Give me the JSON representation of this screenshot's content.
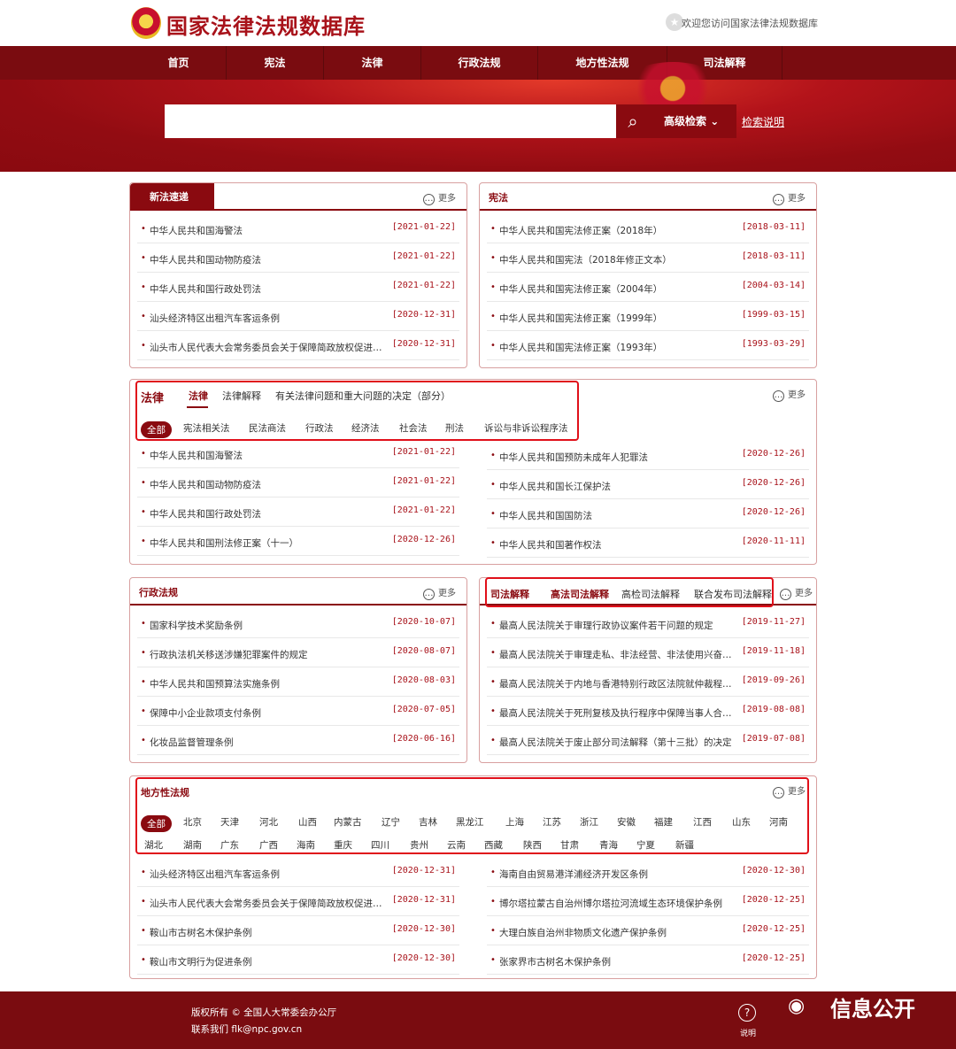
{
  "header": {
    "site_title": "国家法律法规数据库",
    "welcome": "欢迎您访问国家法律法规数据库"
  },
  "nav": [
    "首页",
    "宪法",
    "法律",
    "行政法规",
    "地方性法规",
    "司法解释"
  ],
  "search": {
    "placeholder": "",
    "advanced": "高级检索",
    "help": "检索说明"
  },
  "more": "更多",
  "panel_new": {
    "title": "新法速递",
    "rows": [
      {
        "t": "中华人民共和国海警法",
        "d": "[2021-01-22]"
      },
      {
        "t": "中华人民共和国动物防疫法",
        "d": "[2021-01-22]"
      },
      {
        "t": "中华人民共和国行政处罚法",
        "d": "[2021-01-22]"
      },
      {
        "t": "汕头经济特区出租汽车客运条例",
        "d": "[2020-12-31]"
      },
      {
        "t": "汕头市人民代表大会常务委员会关于保障简政放权促进…",
        "d": "[2020-12-31]"
      }
    ]
  },
  "panel_const": {
    "title": "宪法",
    "rows": [
      {
        "t": "中华人民共和国宪法修正案（2018年）",
        "d": "[2018-03-11]"
      },
      {
        "t": "中华人民共和国宪法（2018年修正文本）",
        "d": "[2018-03-11]"
      },
      {
        "t": "中华人民共和国宪法修正案（2004年）",
        "d": "[2004-03-14]"
      },
      {
        "t": "中华人民共和国宪法修正案（1999年）",
        "d": "[1999-03-15]"
      },
      {
        "t": "中华人民共和国宪法修正案（1993年）",
        "d": "[1993-03-29]"
      }
    ]
  },
  "panel_law": {
    "title": "法律",
    "tabs": [
      "法律",
      "法律解释",
      "有关法律问题和重大问题的决定（部分）"
    ],
    "chips": [
      "全部",
      "宪法相关法",
      "民法商法",
      "行政法",
      "经济法",
      "社会法",
      "刑法",
      "诉讼与非诉讼程序法"
    ],
    "left": [
      {
        "t": "中华人民共和国海警法",
        "d": "[2021-01-22]"
      },
      {
        "t": "中华人民共和国动物防疫法",
        "d": "[2021-01-22]"
      },
      {
        "t": "中华人民共和国行政处罚法",
        "d": "[2021-01-22]"
      },
      {
        "t": "中华人民共和国刑法修正案（十一）",
        "d": "[2020-12-26]"
      }
    ],
    "right": [
      {
        "t": "中华人民共和国预防未成年人犯罪法",
        "d": "[2020-12-26]"
      },
      {
        "t": "中华人民共和国长江保护法",
        "d": "[2020-12-26]"
      },
      {
        "t": "中华人民共和国国防法",
        "d": "[2020-12-26]"
      },
      {
        "t": "中华人民共和国著作权法",
        "d": "[2020-11-11]"
      }
    ]
  },
  "panel_admin": {
    "title": "行政法规",
    "rows": [
      {
        "t": "国家科学技术奖励条例",
        "d": "[2020-10-07]"
      },
      {
        "t": "行政执法机关移送涉嫌犯罪案件的规定",
        "d": "[2020-08-07]"
      },
      {
        "t": "中华人民共和国预算法实施条例",
        "d": "[2020-08-03]"
      },
      {
        "t": "保障中小企业款项支付条例",
        "d": "[2020-07-05]"
      },
      {
        "t": "化妆品监督管理条例",
        "d": "[2020-06-16]"
      }
    ]
  },
  "panel_judicial": {
    "tabs": [
      "司法解释",
      "高法司法解释",
      "高检司法解释",
      "联合发布司法解释"
    ],
    "rows": [
      {
        "t": "最高人民法院关于审理行政协议案件若干问题的规定",
        "d": "[2019-11-27]"
      },
      {
        "t": "最高人民法院关于审理走私、非法经营、非法使用兴奋…",
        "d": "[2019-11-18]"
      },
      {
        "t": "最高人民法院关于内地与香港特别行政区法院就仲裁程…",
        "d": "[2019-09-26]"
      },
      {
        "t": "最高人民法院关于死刑复核及执行程序中保障当事人合…",
        "d": "[2019-08-08]"
      },
      {
        "t": "最高人民法院关于废止部分司法解释（第十三批）的决定",
        "d": "[2019-07-08]"
      }
    ]
  },
  "panel_local": {
    "title": "地方性法规",
    "regions1": [
      "全部",
      "北京",
      "天津",
      "河北",
      "山西",
      "内蒙古",
      "辽宁",
      "吉林",
      "黑龙江",
      "上海",
      "江苏",
      "浙江",
      "安徽",
      "福建",
      "江西",
      "山东",
      "河南"
    ],
    "regions2": [
      "湖北",
      "湖南",
      "广东",
      "广西",
      "海南",
      "重庆",
      "四川",
      "贵州",
      "云南",
      "西藏",
      "陕西",
      "甘肃",
      "青海",
      "宁夏",
      "新疆"
    ],
    "left": [
      {
        "t": "汕头经济特区出租汽车客运条例",
        "d": "[2020-12-31]"
      },
      {
        "t": "汕头市人民代表大会常务委员会关于保障简政放权促进…",
        "d": "[2020-12-31]"
      },
      {
        "t": "鞍山市古树名木保护条例",
        "d": "[2020-12-30]"
      },
      {
        "t": "鞍山市文明行为促进条例",
        "d": "[2020-12-30]"
      }
    ],
    "right": [
      {
        "t": "海南自由贸易港洋浦经济开发区条例",
        "d": "[2020-12-30]"
      },
      {
        "t": "博尔塔拉蒙古自治州博尔塔拉河流域生态环境保护条例",
        "d": "[2020-12-25]"
      },
      {
        "t": "大理白族自治州非物质文化遗产保护条例",
        "d": "[2020-12-25]"
      },
      {
        "t": "张家界市古树名木保护条例",
        "d": "[2020-12-25]"
      }
    ]
  },
  "footer": {
    "copyright": "版权所有 © 全国人大常委会办公厅",
    "contact": "联系我们 flk@npc.gov.cn",
    "help": "说明"
  },
  "watermark": "信息公开"
}
